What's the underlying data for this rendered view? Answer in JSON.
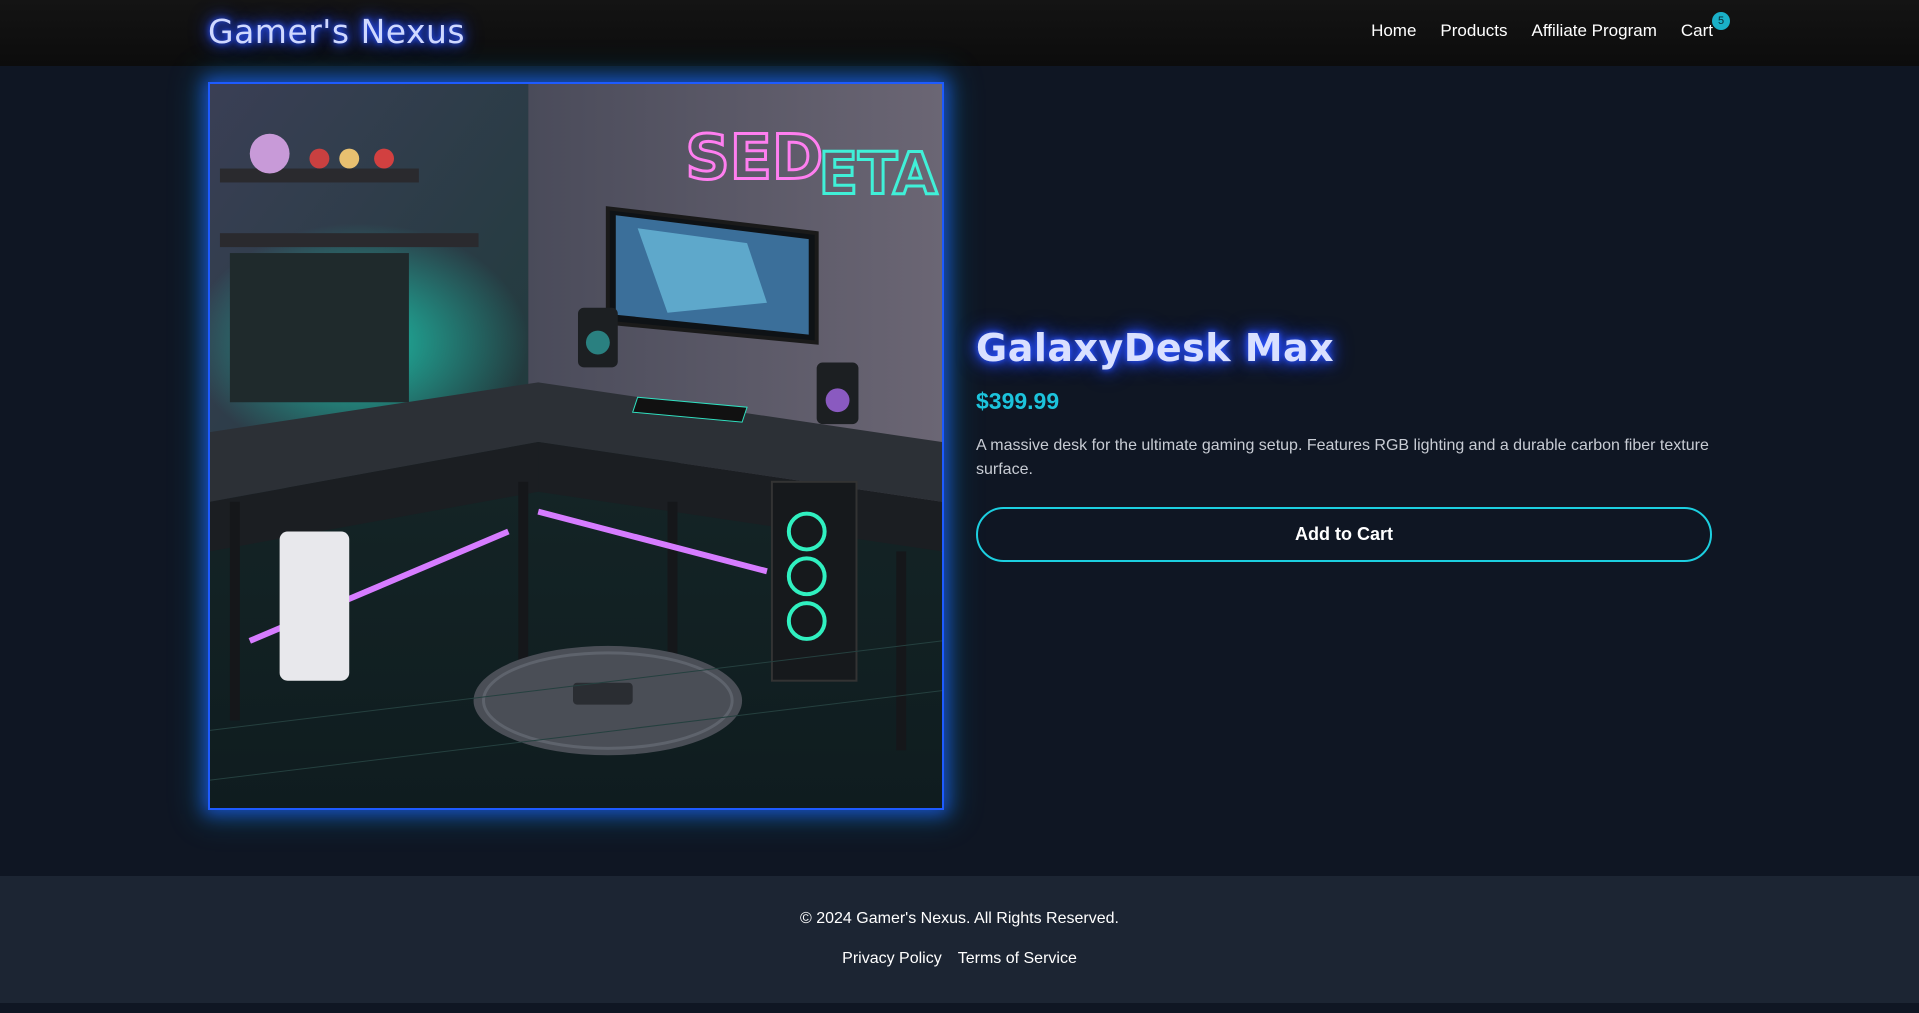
{
  "header": {
    "logo": "Gamer's Nexus",
    "nav": {
      "home": "Home",
      "products": "Products",
      "affiliate": "Affiliate Program",
      "cart": "Cart",
      "cart_count": "5"
    }
  },
  "product": {
    "image_sign_text": "SEDETA",
    "name": "GalaxyDesk Max",
    "price": "$399.99",
    "description": "A massive desk for the ultimate gaming setup. Features RGB lighting and a durable carbon fiber texture surface.",
    "add_to_cart": "Add to Cart"
  },
  "footer": {
    "copyright": "© 2024 Gamer's Nexus. All Rights Reserved.",
    "privacy": "Privacy Policy",
    "terms": "Terms of Service"
  },
  "colors": {
    "page_bg": "#0f1623",
    "header_bg": "#111111",
    "footer_bg": "#1c2533",
    "accent_cyan": "#1cc3dc",
    "glow_blue": "#2b53ff"
  },
  "icons": {
    "product_photo": "gaming-desk-photo"
  }
}
